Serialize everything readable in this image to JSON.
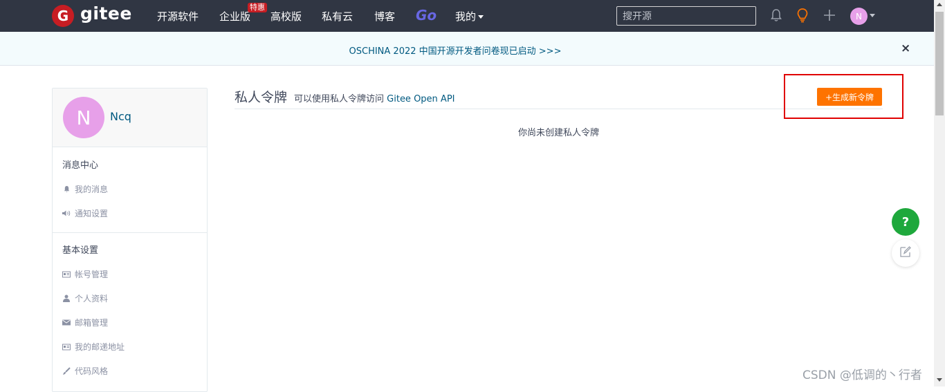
{
  "topbar": {
    "logo_letter": "G",
    "logo_text": "gitee",
    "nav": [
      "开源软件",
      "企业版",
      "高校版",
      "私有云",
      "博客"
    ],
    "badge": "特惠",
    "go": "Go",
    "mine": "我的",
    "search_placeholder": "搜开源",
    "avatar_letter": "N"
  },
  "banner": {
    "text": "OSCHINA 2022 中国开源开发者问卷现已启动 >>>",
    "close": "×"
  },
  "sidebar": {
    "avatar_letter": "N",
    "username": "Ncq",
    "sections": [
      {
        "header": "消息中心",
        "items": [
          "我的消息",
          "通知设置"
        ]
      },
      {
        "header": "基本设置",
        "items": [
          "帐号管理",
          "个人资料",
          "邮箱管理",
          "我的邮递地址",
          "代码风格"
        ]
      }
    ]
  },
  "main": {
    "title": "私人令牌",
    "desc": "可以使用私人令牌访问",
    "api_link": "Gitee Open API",
    "generate_button": "+生成新令牌",
    "empty_text": "你尚未创建私人令牌"
  },
  "fab": {
    "help": "?"
  },
  "watermark": "CSDN @低调的丶行者",
  "colors": {
    "topbar_bg": "#303643",
    "brand_red": "#c71d23",
    "accent_orange": "#fe7300",
    "link_blue": "#005980",
    "help_green": "#1ea83c",
    "highlight_red": "#e00000"
  },
  "icons": {
    "bell": "bell-icon",
    "bulb": "lightbulb-icon",
    "plus": "plus-icon",
    "close": "close-icon"
  }
}
